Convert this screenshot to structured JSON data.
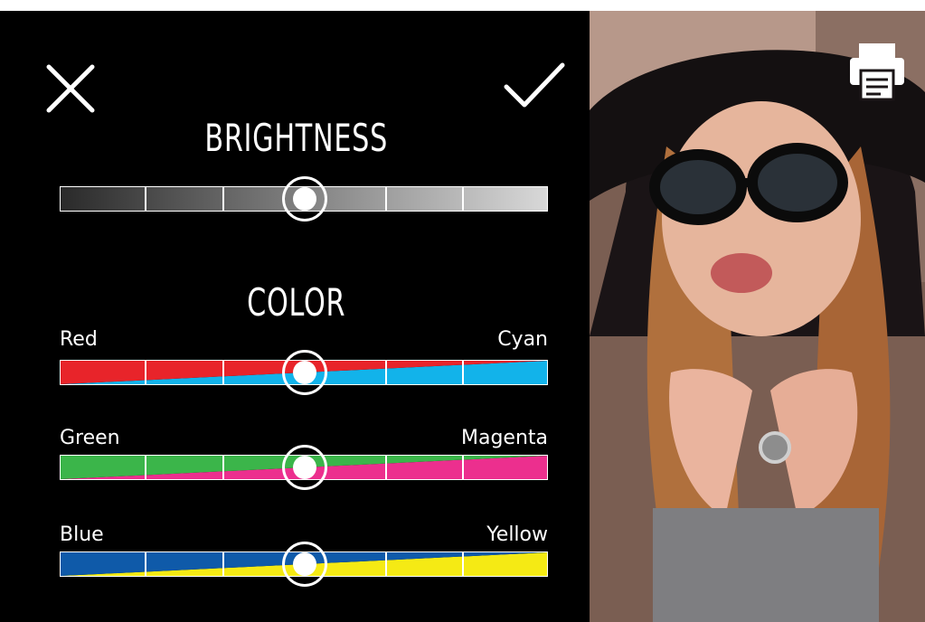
{
  "toolbar": {
    "close_icon": "close-icon",
    "confirm_icon": "check-icon",
    "print_icon": "printer-icon"
  },
  "brightness": {
    "title": "BRIGHTNESS",
    "value_fraction": 0.5
  },
  "color": {
    "title": "COLOR",
    "sliders": [
      {
        "left_label": "Red",
        "right_label": "Cyan",
        "left_color": "#e8242a",
        "right_color": "#12b3ea",
        "value_fraction": 0.5
      },
      {
        "left_label": "Green",
        "right_label": "Magenta",
        "left_color": "#3bb54a",
        "right_color": "#ec2f8e",
        "value_fraction": 0.5
      },
      {
        "left_label": "Blue",
        "right_label": "Yellow",
        "left_color": "#0f5aa9",
        "right_color": "#f5ea14",
        "value_fraction": 0.5
      }
    ]
  },
  "photo": {
    "subject": "preview-photo"
  }
}
